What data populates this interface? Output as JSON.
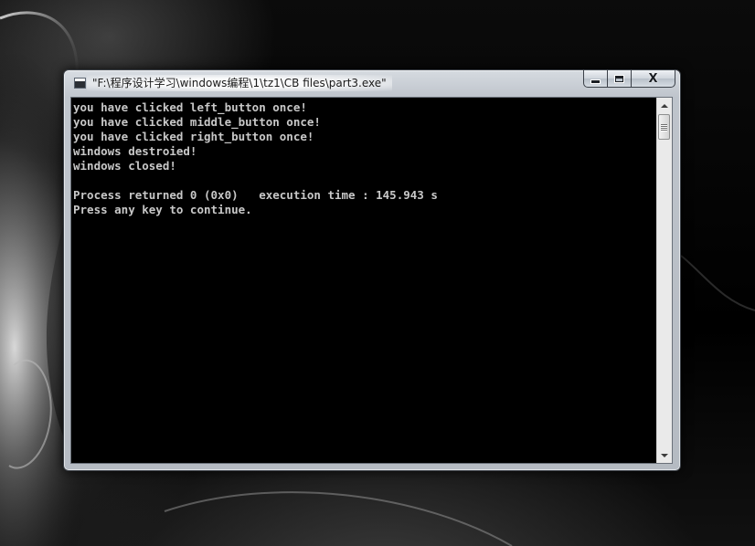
{
  "window": {
    "title": "\"F:\\程序设计学习\\windows编程\\1\\tz1\\CB files\\part3.exe\"",
    "icon": "console-app-icon",
    "buttons": {
      "minimize": "minimize-icon",
      "maximize": "maximize-icon",
      "close_label": "X"
    }
  },
  "console": {
    "lines": [
      "you have clicked left_button once!",
      "you have clicked middle_button once!",
      "you have clicked right_button once!",
      "windows destroied!",
      "windows closed!",
      "",
      "Process returned 0 (0x0)   execution time : 145.943 s",
      "Press any key to continue."
    ],
    "text_color": "#c8c8c8",
    "background_color": "#000000"
  },
  "scrollbar": {
    "up_icon": "scroll-up-arrow-icon",
    "down_icon": "scroll-down-arrow-icon"
  }
}
